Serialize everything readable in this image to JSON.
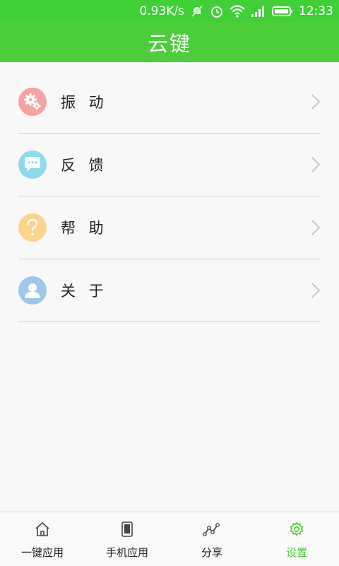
{
  "status_bar": {
    "net_speed": "0.93K/s",
    "time": "12:33"
  },
  "header": {
    "title": "云键"
  },
  "menu": {
    "items": [
      {
        "label": "振 动",
        "icon": "gears-icon",
        "color": "#f5a3a3"
      },
      {
        "label": "反 馈",
        "icon": "chat-bubble-icon",
        "color": "#8fd9ec"
      },
      {
        "label": "帮 助",
        "icon": "question-icon",
        "color": "#f9d58e"
      },
      {
        "label": "关 于",
        "icon": "person-icon",
        "color": "#9fc6ec"
      }
    ]
  },
  "tabbar": {
    "tabs": [
      {
        "label": "一键应用",
        "icon": "home-icon",
        "active": false
      },
      {
        "label": "手机应用",
        "icon": "phone-icon",
        "active": false
      },
      {
        "label": "分享",
        "icon": "share-icon",
        "active": false
      },
      {
        "label": "设置",
        "icon": "settings-gear-icon",
        "active": true
      }
    ]
  },
  "colors": {
    "status_bar": "#3fcf37",
    "title_bar": "#4ccd3a",
    "active_tab": "#4ccd3a"
  }
}
